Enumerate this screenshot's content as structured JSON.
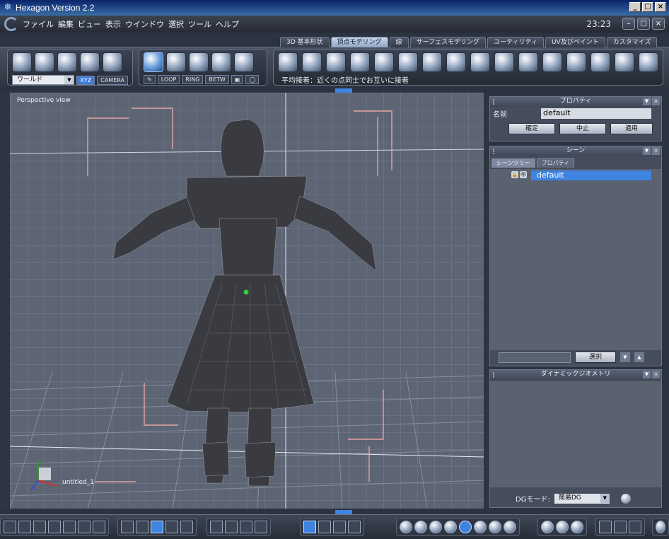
{
  "window": {
    "title": "Hexagon Version 2.2"
  },
  "menu": [
    "ファイル",
    "編集",
    "ビュー",
    "表示",
    "ウインドウ",
    "選択",
    "ツール",
    "ヘルプ"
  ],
  "clock": "23:23",
  "tabs": [
    "3D 基本形状",
    "頂点モデリング",
    "線",
    "サーフェスモデリング",
    "ユーティリティ",
    "UV及びペイント",
    "カスタマイズ"
  ],
  "active_tab_index": 1,
  "toolbar": {
    "coord_dropdown": "ワールド",
    "xyz_label": "XYZ",
    "camera_label": "CAMERA",
    "loop_label": "LOOP",
    "ring_label": "RING",
    "betw_label": "BETW",
    "status_text": "平均接着：近くの点同士でお互いに接着"
  },
  "viewport": {
    "label": "Perspective view",
    "object_label": "untitled_1",
    "axis_x": "x",
    "axis_y": "y",
    "axis_z": "z"
  },
  "properties_panel": {
    "title": "プロパティ",
    "name_label": "名前",
    "name_value": "default",
    "confirm_label": "確定",
    "cancel_label": "中止",
    "apply_label": "適用"
  },
  "scene_panel": {
    "title": "シーン",
    "tabs": [
      "シーンツリー",
      "プロパティ"
    ],
    "items": [
      "default"
    ],
    "select_label": "選択"
  },
  "dynamic_panel": {
    "title": "ダイナミックジオメトリ",
    "dg_mode_label": "DGモード:",
    "dg_mode_value": "簡易DG"
  }
}
